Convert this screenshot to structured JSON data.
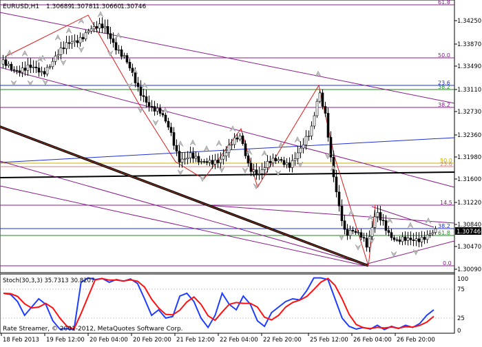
{
  "header": {
    "symbol_tf": "EURUSD,H1",
    "ohlc": [
      "1.30689",
      "1.30781",
      "1.30660",
      "1.30746"
    ]
  },
  "price_axis": {
    "labels": [
      "1.34250",
      "1.33870",
      "1.33490",
      "1.33110",
      "1.32730",
      "1.32360",
      "1.31980",
      "1.31600",
      "1.31220",
      "1.30840",
      "1.30470",
      "1.30090"
    ],
    "current_price": "1.30746"
  },
  "fib_levels": [
    {
      "label": "61.8",
      "color": "#8b1a8b"
    },
    {
      "label": "50.0",
      "color": "#8b1a8b"
    },
    {
      "label": "23.6",
      "color": "#1e2fd0"
    },
    {
      "label": "38.2",
      "color": "#1a8a1a"
    },
    {
      "label": "38.2",
      "color": "#8b1a8b"
    },
    {
      "label": "50.0",
      "color": "#c8b000"
    },
    {
      "label": "23.6",
      "color": "#d08080"
    },
    {
      "label": "14.5",
      "color": "#8b1a8b"
    },
    {
      "label": "38.2",
      "color": "#1e2fd0"
    },
    {
      "label": "61.8",
      "color": "#1a8a1a"
    },
    {
      "label": "0.0",
      "color": "#8b1a8b"
    }
  ],
  "oscillator": {
    "label": "Stoch(30,3,3) 35.7313 30.8207",
    "levels": [
      "100",
      "75",
      "25",
      "0"
    ],
    "main_color": "#1e3cff",
    "signal_color": "#ff1010"
  },
  "time_axis": {
    "labels": [
      "18 Feb 2013",
      "19 Feb 12:00",
      "20 Feb 04:00",
      "20 Feb 20:00",
      "21 Feb 12:00",
      "22 Feb 04:00",
      "22 Feb 20:00",
      "25 Feb 12:00",
      "26 Feb 04:00",
      "26 Feb 20:00"
    ]
  },
  "footer": {
    "copyright": "Rate Streamer, © 2001-2012, MetaQuotes Software Corp."
  }
}
